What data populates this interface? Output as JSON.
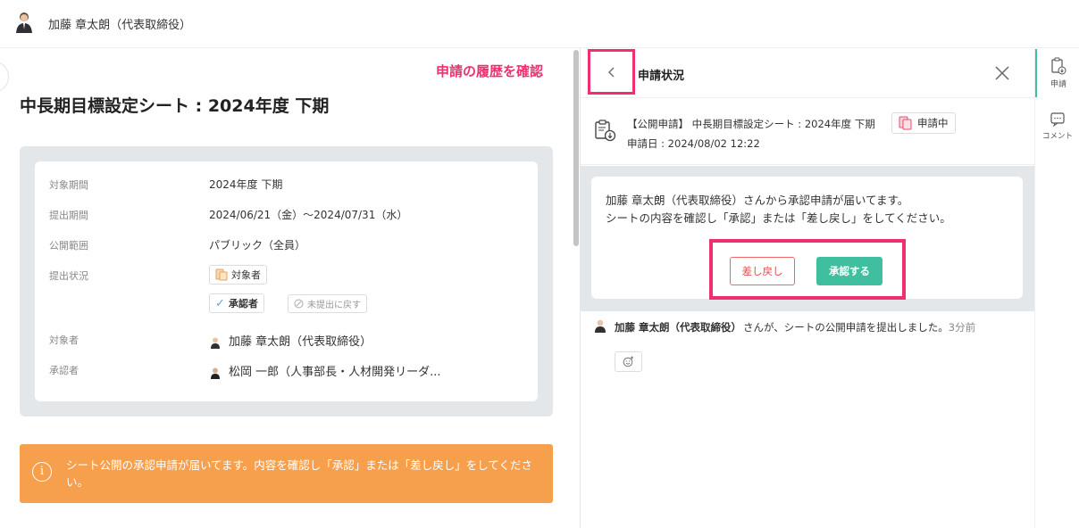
{
  "header": {
    "user_name": "加藤 章太朗（代表取締役）"
  },
  "sheet": {
    "title": "中長期目標設定シート : 2024年度 下期",
    "rows": [
      {
        "label": "対象期間",
        "value": "2024年度 下期"
      },
      {
        "label": "提出期間",
        "value": "2024/06/21（金）～2024/07/31（水）"
      },
      {
        "label": "公開範囲",
        "value": "パブリック（全員）"
      },
      {
        "label": "提出状況",
        "value": ""
      },
      {
        "label": "対象者",
        "value": "加藤 章太朗（代表取締役）"
      },
      {
        "label": "承認者",
        "value": "松岡 一郎（人事部長・人材開発リーダ..."
      }
    ],
    "status_chips": {
      "target": "対象者",
      "approver": "承認者",
      "revert": "未提出に戻す"
    }
  },
  "notice": {
    "text": "シート公開の承認申請が届いてます。内容を確認し「承認」または「差し戻し」をしてください。"
  },
  "annotation": {
    "text": "申請の履歴を確認"
  },
  "panel": {
    "title": "申請状況",
    "apply_title": "【公開申請】 中長期目標設定シート : 2024年度 下期",
    "status": "申請中",
    "apply_date": "申請日 : 2024/08/02 12:22",
    "message_line1": "加藤 章太朗（代表取締役）さんから承認申請が届いてます。",
    "message_line2": "シートの内容を確認し「承認」または「差し戻し」をしてください。",
    "reject_label": "差し戻し",
    "approve_label": "承認する",
    "activity_name": "加藤 章太朗（代表取締役）",
    "activity_text": "さんが、シートの公開申請を提出しました。",
    "activity_time": "3分前"
  },
  "sidebar": {
    "items": [
      {
        "label": "申請"
      },
      {
        "label": "コメント"
      }
    ]
  },
  "colors": {
    "accent": "#3fbfa0",
    "annotation": "#f0306e",
    "notice": "#f6a04d"
  }
}
